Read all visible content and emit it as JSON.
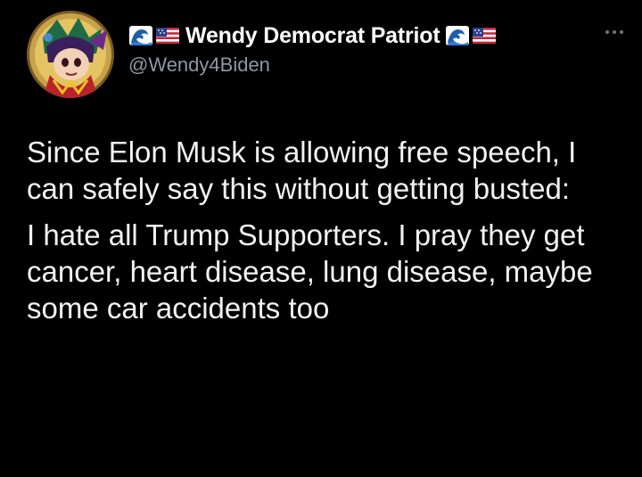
{
  "tweet": {
    "author": {
      "display_name": "Wendy Democrat Patriot",
      "handle": "@Wendy4Biden",
      "name_emojis_before": [
        "wave-emoji",
        "us-flag-emoji"
      ],
      "name_emojis_after": [
        "wave-emoji",
        "us-flag-emoji"
      ],
      "avatar_icon": "cartoon-avatar"
    },
    "more_icon": "ellipsis-icon",
    "paragraphs": [
      "Since Elon Musk is allowing free speech, I can safely say this without getting busted:",
      "I hate all Trump Supporters. I pray they get cancer, heart disease, lung disease, maybe some car accidents too"
    ]
  },
  "colors": {
    "background": "#000000",
    "text": "#e7e9ea",
    "secondary_text": "#8b98a5"
  }
}
